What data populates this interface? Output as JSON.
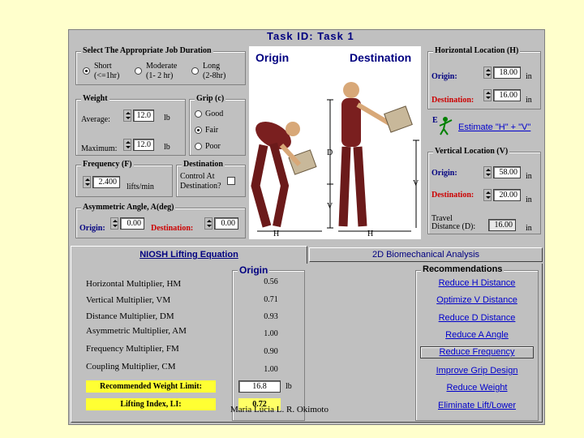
{
  "task_title": "Task ID: Task 1",
  "job_duration": {
    "title": "Select The Appropriate Job Duration",
    "options": [
      {
        "label": "Short",
        "sub": "(<=1hr)",
        "selected": true
      },
      {
        "label": "Moderate",
        "sub": "(1- 2 hr)",
        "selected": false
      },
      {
        "label": "Long",
        "sub": "(2-8hr)",
        "selected": false
      }
    ]
  },
  "weight": {
    "title": "Weight",
    "average_label": "Average:",
    "average_value": "12.0",
    "maximum_label": "Maximum:",
    "maximum_value": "12.0",
    "unit": "lb"
  },
  "grip": {
    "title": "Grip (c)",
    "options": [
      {
        "label": "Good",
        "selected": false
      },
      {
        "label": "Fair",
        "selected": true
      },
      {
        "label": "Poor",
        "selected": false
      }
    ]
  },
  "frequency": {
    "title": "Frequency (F)",
    "value": "2.400",
    "unit": "lifts/min"
  },
  "destination_box": {
    "title": "Destination",
    "line1": "Control At",
    "line2": "Destination?"
  },
  "asymmetric": {
    "title": "Asymmetric Angle, A(deg)",
    "origin_label": "Origin:",
    "origin_value": "0.00",
    "destination_label": "Destination:",
    "destination_value": "0.00"
  },
  "figure": {
    "origin_label": "Origin",
    "destination_label": "Destination",
    "d_marker": "D",
    "v_marker": "V",
    "h_marker": "H",
    "v_marker2": "V",
    "h_marker2": "H"
  },
  "horizontal": {
    "title": "Horizontal Location (H)",
    "origin_label": "Origin:",
    "origin_value": "18.00",
    "destination_label": "Destination:",
    "destination_value": "16.00",
    "unit": "in"
  },
  "estimate": {
    "label": "Estimate \"H\" + \"V\"",
    "e_char": "E"
  },
  "vertical": {
    "title": "Vertical Location (V)",
    "origin_label": "Origin:",
    "origin_value": "58.00",
    "destination_label": "Destination:",
    "destination_value": "20.00",
    "unit": "in",
    "travel_label_1": "Travel",
    "travel_label_2": "Distance (D):",
    "travel_value": "16.00"
  },
  "tabs": [
    {
      "label": "NIOSH Lifting Equation",
      "active": true
    },
    {
      "label": "2D Biomechanical Analysis",
      "active": false
    }
  ],
  "origin_header": "Origin",
  "multipliers": [
    {
      "label": "Horizontal Multiplier, HM",
      "value": "0.56"
    },
    {
      "label": "Vertical Multiplier, VM",
      "value": "0.71"
    },
    {
      "label": "Distance Multiplier, DM",
      "value": "0.93"
    },
    {
      "label": "Asymmetric Multiplier, AM",
      "value": "1.00"
    },
    {
      "label": "Frequency Multiplier, FM",
      "value": "0.90"
    },
    {
      "label": "Coupling Multiplier, CM",
      "value": "1.00"
    }
  ],
  "rwl": {
    "label": "Recommended Weight Limit:",
    "value": "16.8",
    "unit": "lb"
  },
  "li": {
    "label": "Lifting Index, LI:",
    "value": "0.72"
  },
  "recommendations": {
    "title": "Recommendations",
    "items": [
      "Reduce H Distance",
      "Optimize V Distance",
      "Reduce D Distance",
      "Reduce A Angle",
      "Reduce Frequency",
      "Improve Grip Design",
      "Reduce Weight",
      "Eliminate Lift/Lower"
    ]
  },
  "caption": "Maria Lúcia L. R. Okimoto",
  "colors": {
    "background": "#ffffcc",
    "panel": "#c0c0c0",
    "accent_blue": "#000080",
    "accent_red": "#cc0000",
    "highlight": "#ffff33"
  }
}
